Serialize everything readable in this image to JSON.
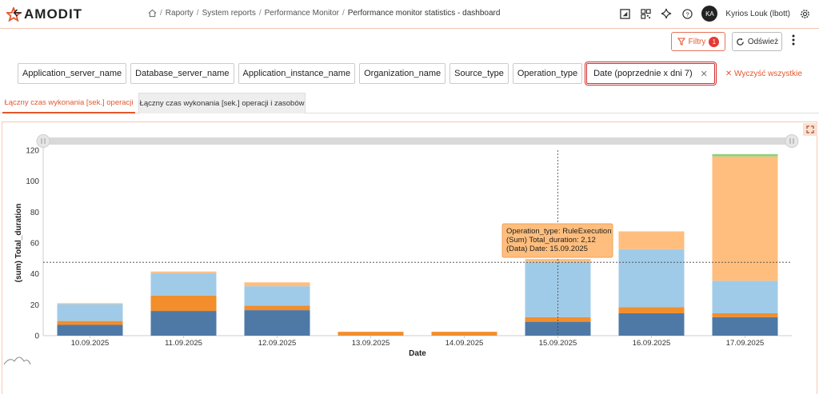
{
  "app": {
    "brand": "AMODIT"
  },
  "breadcrumb": {
    "items": [
      "Raporty",
      "System reports",
      "Performance Monitor"
    ],
    "current": "Performance monitor statistics - dashboard"
  },
  "user": {
    "initials": "KA",
    "name": "Kyrios Louk (lbott)"
  },
  "toolbar": {
    "filter_label": "Filtry",
    "filter_count": "1",
    "refresh_label": "Odśwież"
  },
  "filters": {
    "chips": [
      "Application_server_name",
      "Database_server_name",
      "Application_instance_name",
      "Organization_name",
      "Source_type",
      "Operation_type"
    ],
    "active_chip": "Date (poprzednie x dni 7)",
    "clear_all": "Wyczyść wszystkie"
  },
  "tabs": [
    "Łączny czas wykonania [sek.] operacji",
    "Łączny czas wykonania [sek.] operacji i zasobów"
  ],
  "tooltip": {
    "line1": "Operation_type: RuleExecution",
    "line2": "(Sum) Total_duration: 2,12",
    "line3": "(Data) Date: 15.09.2025"
  },
  "colors": {
    "accent": "#e4572e",
    "s1": "#4e79a7",
    "s2": "#f28e2b",
    "s3": "#a0cbe8",
    "s4": "#ffbe7d",
    "s5": "#8cd17d"
  },
  "chart_data": {
    "type": "bar",
    "stacked": true,
    "xlabel": "Date",
    "ylabel": "(sum) Total_duration",
    "ylim": [
      0,
      120
    ],
    "yticks": [
      0,
      20,
      40,
      60,
      80,
      100,
      120
    ],
    "categories": [
      "10.09.2025",
      "11.09.2025",
      "12.09.2025",
      "13.09.2025",
      "14.09.2025",
      "15.09.2025",
      "16.09.2025",
      "17.09.2025"
    ],
    "series": [
      {
        "color": "#4e79a7",
        "values": [
          7,
          16,
          16.5,
          0,
          0,
          9,
          14.5,
          12
        ]
      },
      {
        "color": "#f28e2b",
        "values": [
          2.5,
          10,
          3,
          2.5,
          2.5,
          3,
          4,
          2.5
        ]
      },
      {
        "color": "#a0cbe8",
        "values": [
          11,
          14.5,
          12.5,
          0,
          0,
          35.5,
          37.5,
          21
        ]
      },
      {
        "color": "#ffbe7d",
        "values": [
          0.5,
          1,
          2.5,
          0,
          0,
          2.12,
          11.5,
          80.5
        ]
      },
      {
        "color": "#8cd17d",
        "values": [
          0,
          0,
          0,
          0,
          0,
          0,
          0,
          1.5
        ]
      }
    ],
    "crosshair": {
      "x": "15.09.2025",
      "y": 47.5
    },
    "grid": false,
    "legend": "none"
  }
}
